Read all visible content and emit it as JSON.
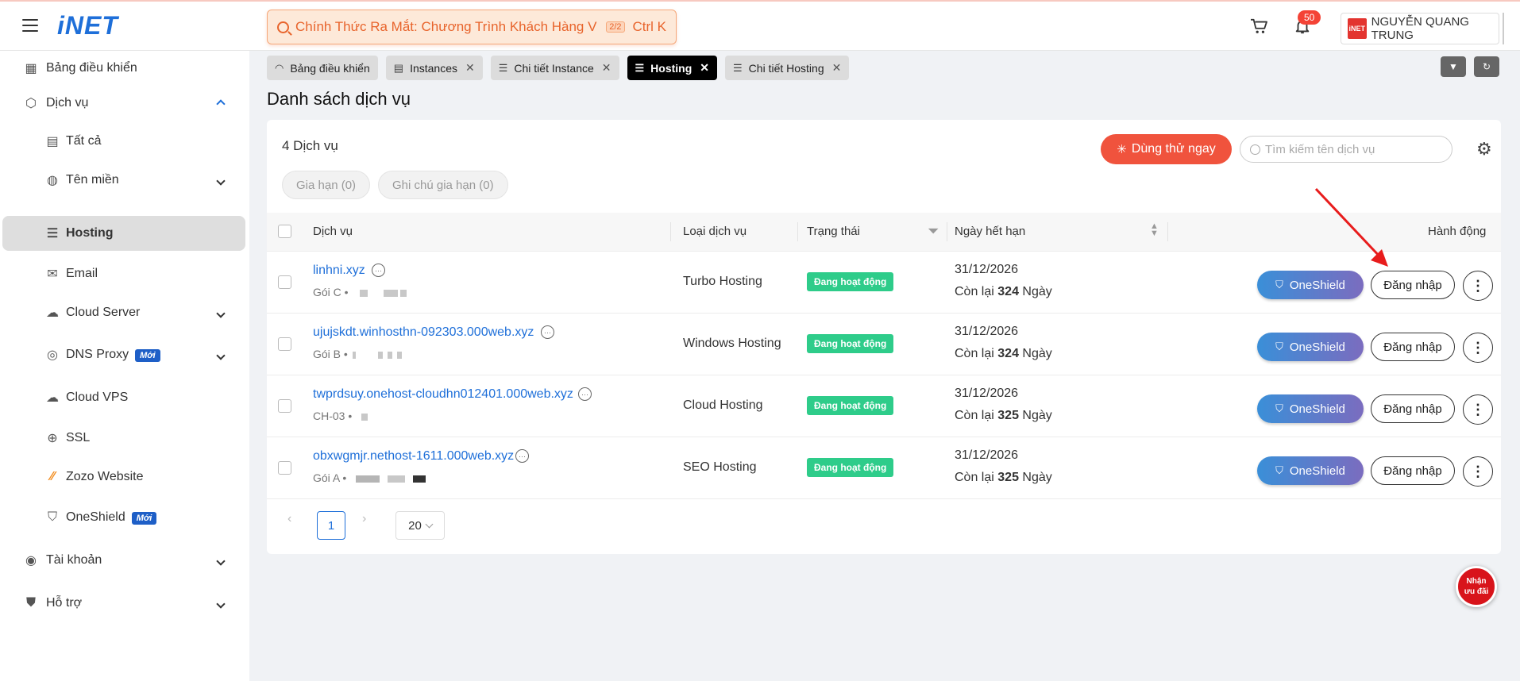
{
  "header": {
    "logo": "iNET",
    "banner_text": "Chính Thức Ra Mắt: Chương Trình Khách Hàng VIP",
    "banner_count": "2/2",
    "shortcut": "Ctrl K",
    "notification_count": "50",
    "user_avatar_text": "iNET",
    "user_name": "NGUYỄN QUANG TRUNG"
  },
  "sidebar": {
    "items": [
      {
        "label": "Bảng điều khiển",
        "icon": "dashboard-icon"
      },
      {
        "label": "Dịch vụ",
        "icon": "box-icon"
      },
      {
        "label": "Tất cả",
        "icon": "list-icon"
      },
      {
        "label": "Tên miền",
        "icon": "globe-icon"
      },
      {
        "label": "Hosting",
        "icon": "server-icon"
      },
      {
        "label": "Email",
        "icon": "mail-icon"
      },
      {
        "label": "Cloud Server",
        "icon": "cloud-server-icon"
      },
      {
        "label": "DNS Proxy",
        "icon": "dns-icon",
        "badge": "Mới"
      },
      {
        "label": "Cloud VPS",
        "icon": "cloud-icon"
      },
      {
        "label": "SSL",
        "icon": "ssl-icon"
      },
      {
        "label": "Zozo Website",
        "icon": "zozo-icon"
      },
      {
        "label": "OneShield",
        "icon": "shield-icon",
        "badge": "Mới"
      },
      {
        "label": "Tài khoản",
        "icon": "user-icon"
      },
      {
        "label": "Hỗ trợ",
        "icon": "support-icon"
      }
    ]
  },
  "tabs": [
    {
      "label": "Bảng điều khiển"
    },
    {
      "label": "Instances"
    },
    {
      "label": "Chi tiết Instance"
    },
    {
      "label": "Hosting"
    },
    {
      "label": "Chi tiết Hosting"
    }
  ],
  "page_title": "Danh sách dịch vụ",
  "toolbar": {
    "count_label": "4 Dịch vụ",
    "chip_renew": "Gia hạn (0)",
    "chip_note": "Ghi chú gia hạn (0)",
    "try_button": "Dùng thử ngay",
    "search_placeholder": "Tìm kiếm tên dịch vụ"
  },
  "table": {
    "headers": {
      "service": "Dịch vụ",
      "type": "Loại dịch vụ",
      "status": "Trạng thái",
      "expiry": "Ngày hết hạn",
      "actions": "Hành động"
    },
    "remain_prefix": "Còn lại",
    "remain_suffix": "Ngày",
    "oneshield_label": "OneShield",
    "login_label": "Đăng nhập",
    "rows": [
      {
        "name": "linhni.xyz",
        "plan": "Gói C •",
        "type": "Turbo Hosting",
        "status": "Đang hoạt động",
        "date": "31/12/2026",
        "days": "324"
      },
      {
        "name": "ujujskdt.winhosthn-092303.000web.xyz",
        "plan": "Gói B •",
        "type": "Windows Hosting",
        "status": "Đang hoạt động",
        "date": "31/12/2026",
        "days": "324"
      },
      {
        "name": "twprdsuy.onehost-cloudhn012401.000web.xyz",
        "plan": "CH-03 •",
        "type": "Cloud Hosting",
        "status": "Đang hoạt động",
        "date": "31/12/2026",
        "days": "325"
      },
      {
        "name": "obxwgmjr.nethost-1611.000web.xyz",
        "plan": "Gói A •",
        "type": "SEO Hosting",
        "status": "Đang hoạt động",
        "date": "31/12/2026",
        "days": "325"
      }
    ]
  },
  "pagination": {
    "page": "1",
    "page_size": "20"
  },
  "promo": {
    "line1": "Nhận",
    "line2": "ưu đãi"
  },
  "colors": {
    "brand": "#1e6fd9",
    "accent": "#f0533d",
    "status": "#2ecc8a"
  }
}
